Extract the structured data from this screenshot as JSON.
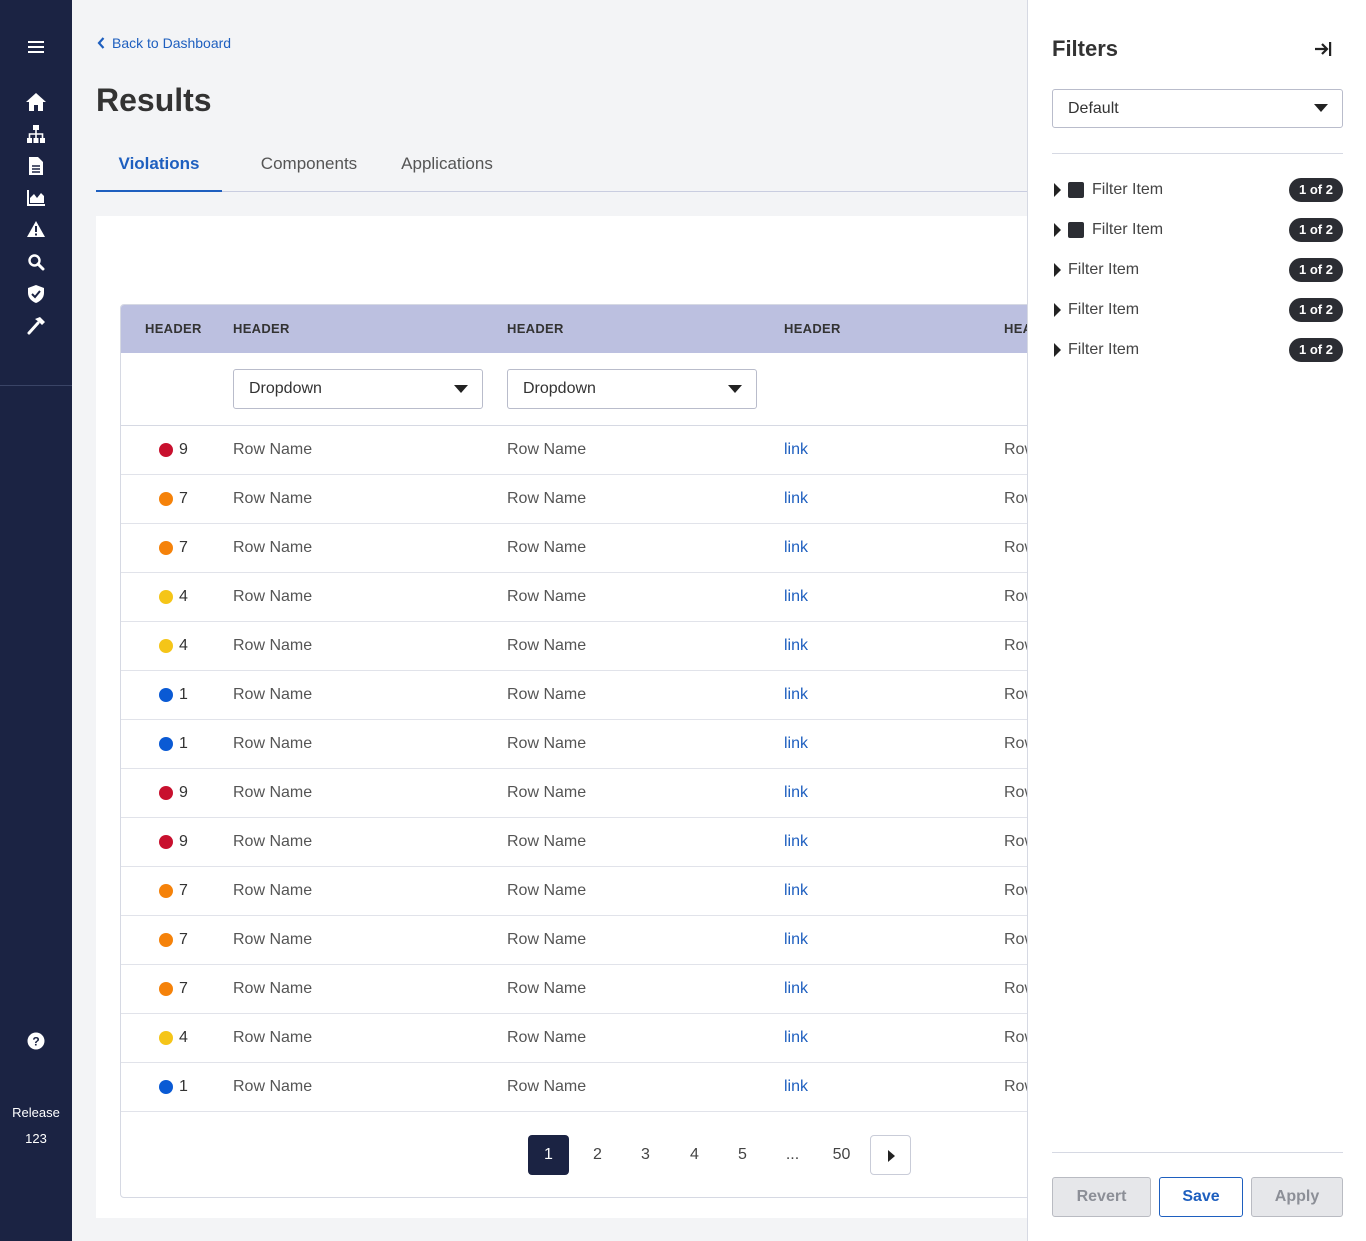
{
  "sidebar": {
    "icons": [
      "home-icon",
      "sitemap-icon",
      "file-icon",
      "chart-icon",
      "warning-icon",
      "search-icon",
      "shield-icon",
      "hammer-icon"
    ],
    "release_label": "Release",
    "release_number": "123"
  },
  "nav": {
    "back_label": "Back to Dashboard"
  },
  "page": {
    "title": "Results"
  },
  "tabs": [
    {
      "label": "Violations",
      "active": true
    },
    {
      "label": "Components",
      "active": false
    },
    {
      "label": "Applications",
      "active": false
    }
  ],
  "table": {
    "headers": [
      "HEADER",
      "HEADER",
      "HEADER",
      "HEADER",
      "HEADER"
    ],
    "dropdowns": [
      "Dropdown",
      "Dropdown"
    ],
    "severity_colors": {
      "9": "#c8102e",
      "7": "#f5820a",
      "4": "#f5c518",
      "1": "#0a5ad4"
    },
    "rows": [
      {
        "severity": "9",
        "name1": "Row Name",
        "name2": "Row Name",
        "link": "link",
        "name3": "Row Name"
      },
      {
        "severity": "7",
        "name1": "Row Name",
        "name2": "Row Name",
        "link": "link",
        "name3": "Row Name"
      },
      {
        "severity": "7",
        "name1": "Row Name",
        "name2": "Row Name",
        "link": "link",
        "name3": "Row Name"
      },
      {
        "severity": "4",
        "name1": "Row Name",
        "name2": "Row Name",
        "link": "link",
        "name3": "Row Name"
      },
      {
        "severity": "4",
        "name1": "Row Name",
        "name2": "Row Name",
        "link": "link",
        "name3": "Row Name"
      },
      {
        "severity": "1",
        "name1": "Row Name",
        "name2": "Row Name",
        "link": "link",
        "name3": "Row Name"
      },
      {
        "severity": "1",
        "name1": "Row Name",
        "name2": "Row Name",
        "link": "link",
        "name3": "Row Name"
      },
      {
        "severity": "9",
        "name1": "Row Name",
        "name2": "Row Name",
        "link": "link",
        "name3": "Row Name"
      },
      {
        "severity": "9",
        "name1": "Row Name",
        "name2": "Row Name",
        "link": "link",
        "name3": "Row Name"
      },
      {
        "severity": "7",
        "name1": "Row Name",
        "name2": "Row Name",
        "link": "link",
        "name3": "Row Name"
      },
      {
        "severity": "7",
        "name1": "Row Name",
        "name2": "Row Name",
        "link": "link",
        "name3": "Row Name"
      },
      {
        "severity": "7",
        "name1": "Row Name",
        "name2": "Row Name",
        "link": "link",
        "name3": "Row Name"
      },
      {
        "severity": "4",
        "name1": "Row Name",
        "name2": "Row Name",
        "link": "link",
        "name3": "Row Name"
      },
      {
        "severity": "1",
        "name1": "Row Name",
        "name2": "Row Name",
        "link": "link",
        "name3": "Row Name"
      }
    ]
  },
  "pagination": {
    "pages": [
      "1",
      "2",
      "3",
      "4",
      "5",
      "...",
      "50"
    ],
    "current": "1"
  },
  "filters": {
    "title": "Filters",
    "preset": "Default",
    "items": [
      {
        "label": "Filter Item",
        "badge": "1 of 2",
        "checked": true
      },
      {
        "label": "Filter Item",
        "badge": "1 of 2",
        "checked": true
      },
      {
        "label": "Filter Item",
        "badge": "1 of 2",
        "checked": false
      },
      {
        "label": "Filter Item",
        "badge": "1 of 2",
        "checked": false
      },
      {
        "label": "Filter Item",
        "badge": "1 of 2",
        "checked": false
      }
    ],
    "revert_label": "Revert",
    "save_label": "Save",
    "apply_label": "Apply"
  }
}
